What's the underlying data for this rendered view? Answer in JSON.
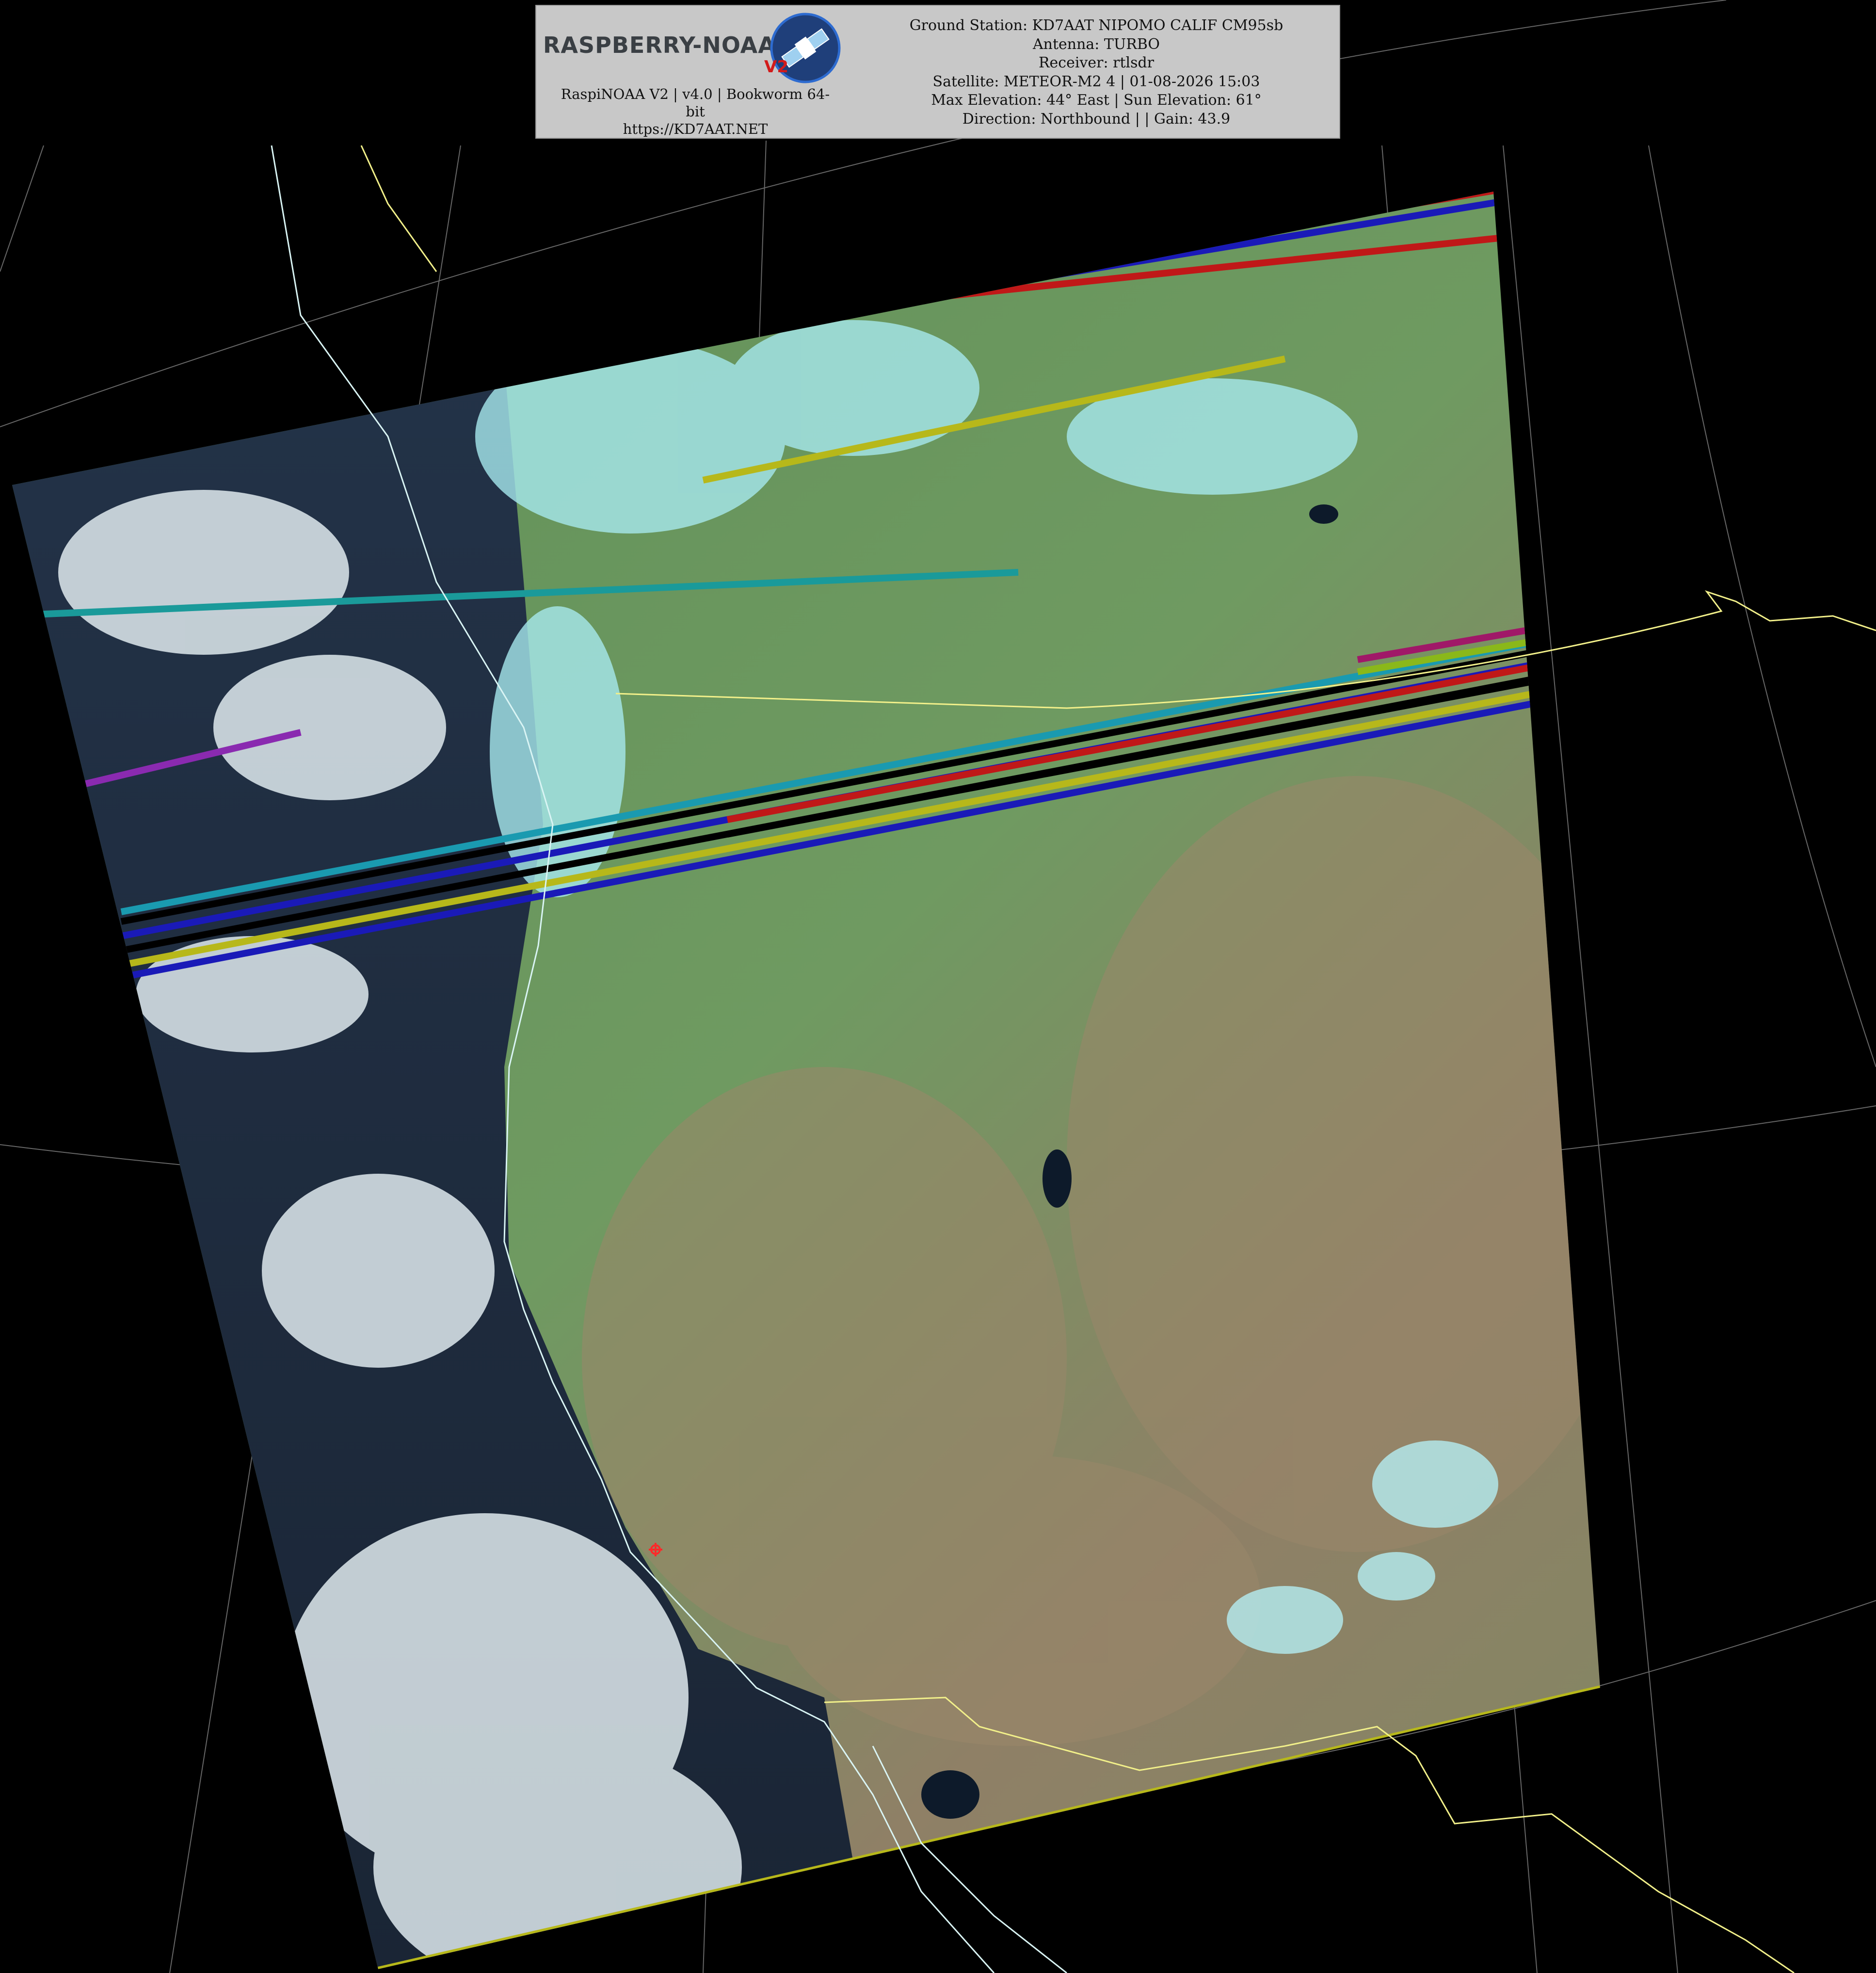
{
  "header": {
    "logo_text": "RASPBERRY-NOAA",
    "logo_version": "V2",
    "software_line1": "RaspiNOAA V2 | v4.0 | Bookworm 64-",
    "software_line2": "bit",
    "website": "https://KD7AAT.NET",
    "ground_station": "Ground Station: KD7AAT NIPOMO CALIF CM95sb",
    "antenna": "Antenna: TURBO",
    "receiver": "Receiver: rtlsdr",
    "satellite": "Satellite: METEOR-M2 4 | 01-08-2026 15:03",
    "elevation": "Max Elevation: 44° East | Sun Elevation: 61°",
    "direction": "Direction: Northbound | | Gain: 43.9"
  },
  "colors": {
    "background": "#000000",
    "panel": "#c8c8c8",
    "land": "#6f9a61",
    "land_dry": "#8f8066",
    "ocean": "#1c2a3c",
    "cloud": "#e6f1f4",
    "cloud_cyan": "#a6e8ee",
    "border_line": "#f2f08a",
    "coastline": "#d9f4f4",
    "graticule": "#9a9a9a",
    "station_marker": "#ff2a2a"
  }
}
